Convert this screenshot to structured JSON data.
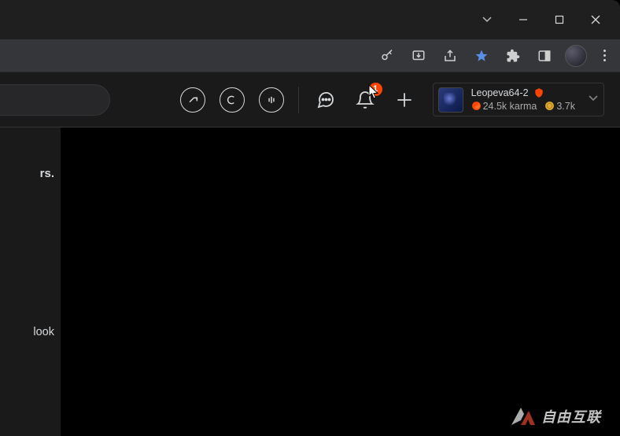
{
  "window": {
    "min": "−",
    "max": "☐",
    "close": "✕"
  },
  "toolbar": {
    "key_icon": "key-icon",
    "install_icon": "install-icon",
    "share_icon": "share-icon",
    "star_icon": "star-icon",
    "ext_icon": "extensions-icon",
    "sidepanel_icon": "sidepanel-icon"
  },
  "header": {
    "notif_count": "1",
    "user": {
      "name": "Leopeva64-2",
      "karma": "24.5k karma",
      "coins": "3.7k"
    }
  },
  "sidebar": {
    "frag1": "rs.",
    "frag2": "look"
  },
  "watermark": {
    "text": "自由互联"
  }
}
